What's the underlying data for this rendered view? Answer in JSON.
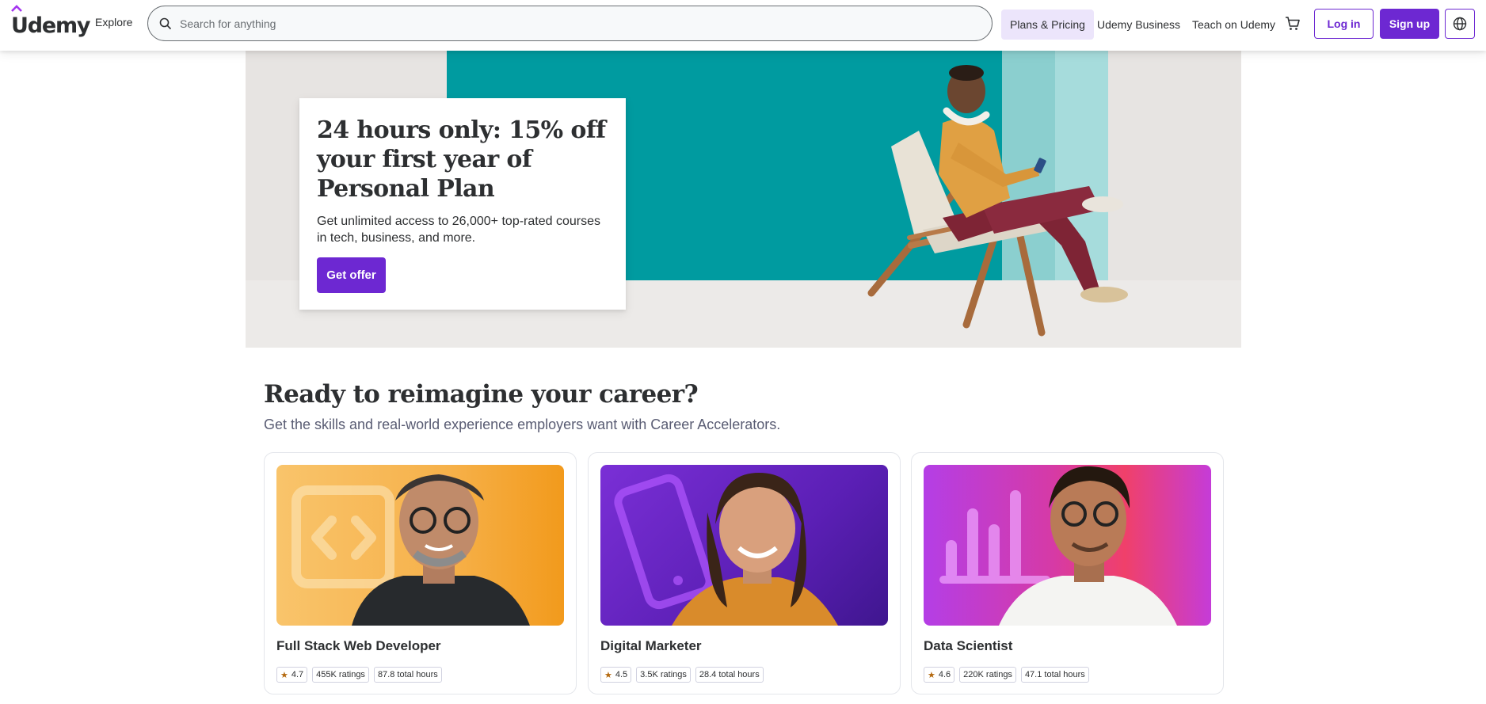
{
  "header": {
    "logo_text": "Udemy",
    "explore_label": "Explore",
    "search_placeholder": "Search for anything",
    "nav": {
      "plans": "Plans & Pricing",
      "business": "Udemy Business",
      "teach": "Teach on Udemy"
    },
    "login_label": "Log in",
    "signup_label": "Sign up",
    "icons": [
      "search-icon",
      "cart-icon",
      "globe-icon"
    ],
    "accent_color": "#6d28d2"
  },
  "hero": {
    "title": "24 hours only: 15% off your first year of Personal Plan",
    "description": "Get unlimited access to 26,000+ top-rated courses in tech, business, and more.",
    "cta_label": "Get offer"
  },
  "career": {
    "title": "Ready to reimagine your career?",
    "subtitle": "Get the skills and real-world experience employers want with Career Accelerators.",
    "cards": [
      {
        "title": "Full Stack Web Developer",
        "rating": "4.7",
        "ratings": "455K ratings",
        "hours": "87.8 total hours",
        "icon": "code-icon"
      },
      {
        "title": "Digital Marketer",
        "rating": "4.5",
        "ratings": "3.5K ratings",
        "hours": "28.4 total hours",
        "icon": "phone-icon"
      },
      {
        "title": "Data Scientist",
        "rating": "4.6",
        "ratings": "220K ratings",
        "hours": "47.1 total hours",
        "icon": "bar-chart-icon"
      }
    ]
  }
}
